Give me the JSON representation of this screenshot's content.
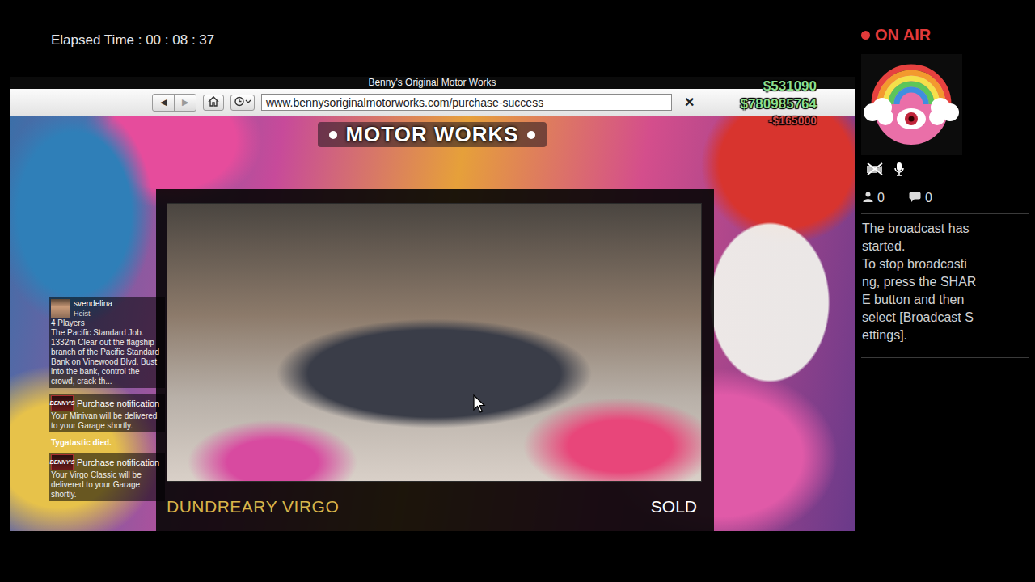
{
  "stream": {
    "elapsed": "Elapsed Time : 00 : 08 : 37"
  },
  "broadcast": {
    "status": "ON AIR",
    "camera_on": false,
    "mic_on": true,
    "viewers": "0",
    "comments": "0",
    "message_lines": [
      "The broadcast has",
      "started.",
      "To stop broadcasti",
      "ng, press the SHAR",
      "E button and then",
      "select [Broadcast S",
      "ettings]."
    ]
  },
  "browser": {
    "title": "Benny's Original Motor Works",
    "nav": [
      {
        "label": "◀",
        "disabled": false
      },
      {
        "label": "▶",
        "disabled": true
      }
    ],
    "url": "www.bennysoriginalmotorworks.com/purchase-success",
    "close": "✕"
  },
  "page": {
    "header": "MOTOR WORKS",
    "vehicle": "DUNDREARY VIRGO",
    "status": "SOLD"
  },
  "hud": {
    "cash": "$531090",
    "bank": "$780985764",
    "change": "-$165000"
  },
  "feed": [
    {
      "kind": "invite",
      "sender": "svendelina",
      "type": "Heist",
      "players": "4 Players",
      "body": "The Pacific Standard Job. 1332m Clear out the flagship branch of the Pacific Standard Bank on Vinewood Blvd. Bust into the bank, control the crowd, crack th..."
    },
    {
      "kind": "notification",
      "logo": "BENNY'S",
      "title": "Purchase notification",
      "body": "Your Minivan will be delivered to your Garage shortly."
    },
    {
      "kind": "event",
      "body": "Tygatastic died."
    },
    {
      "kind": "notification",
      "logo": "BENNY'S",
      "title": "Purchase notification",
      "body": "Your Virgo Classic will be delivered to your Garage shortly."
    }
  ]
}
